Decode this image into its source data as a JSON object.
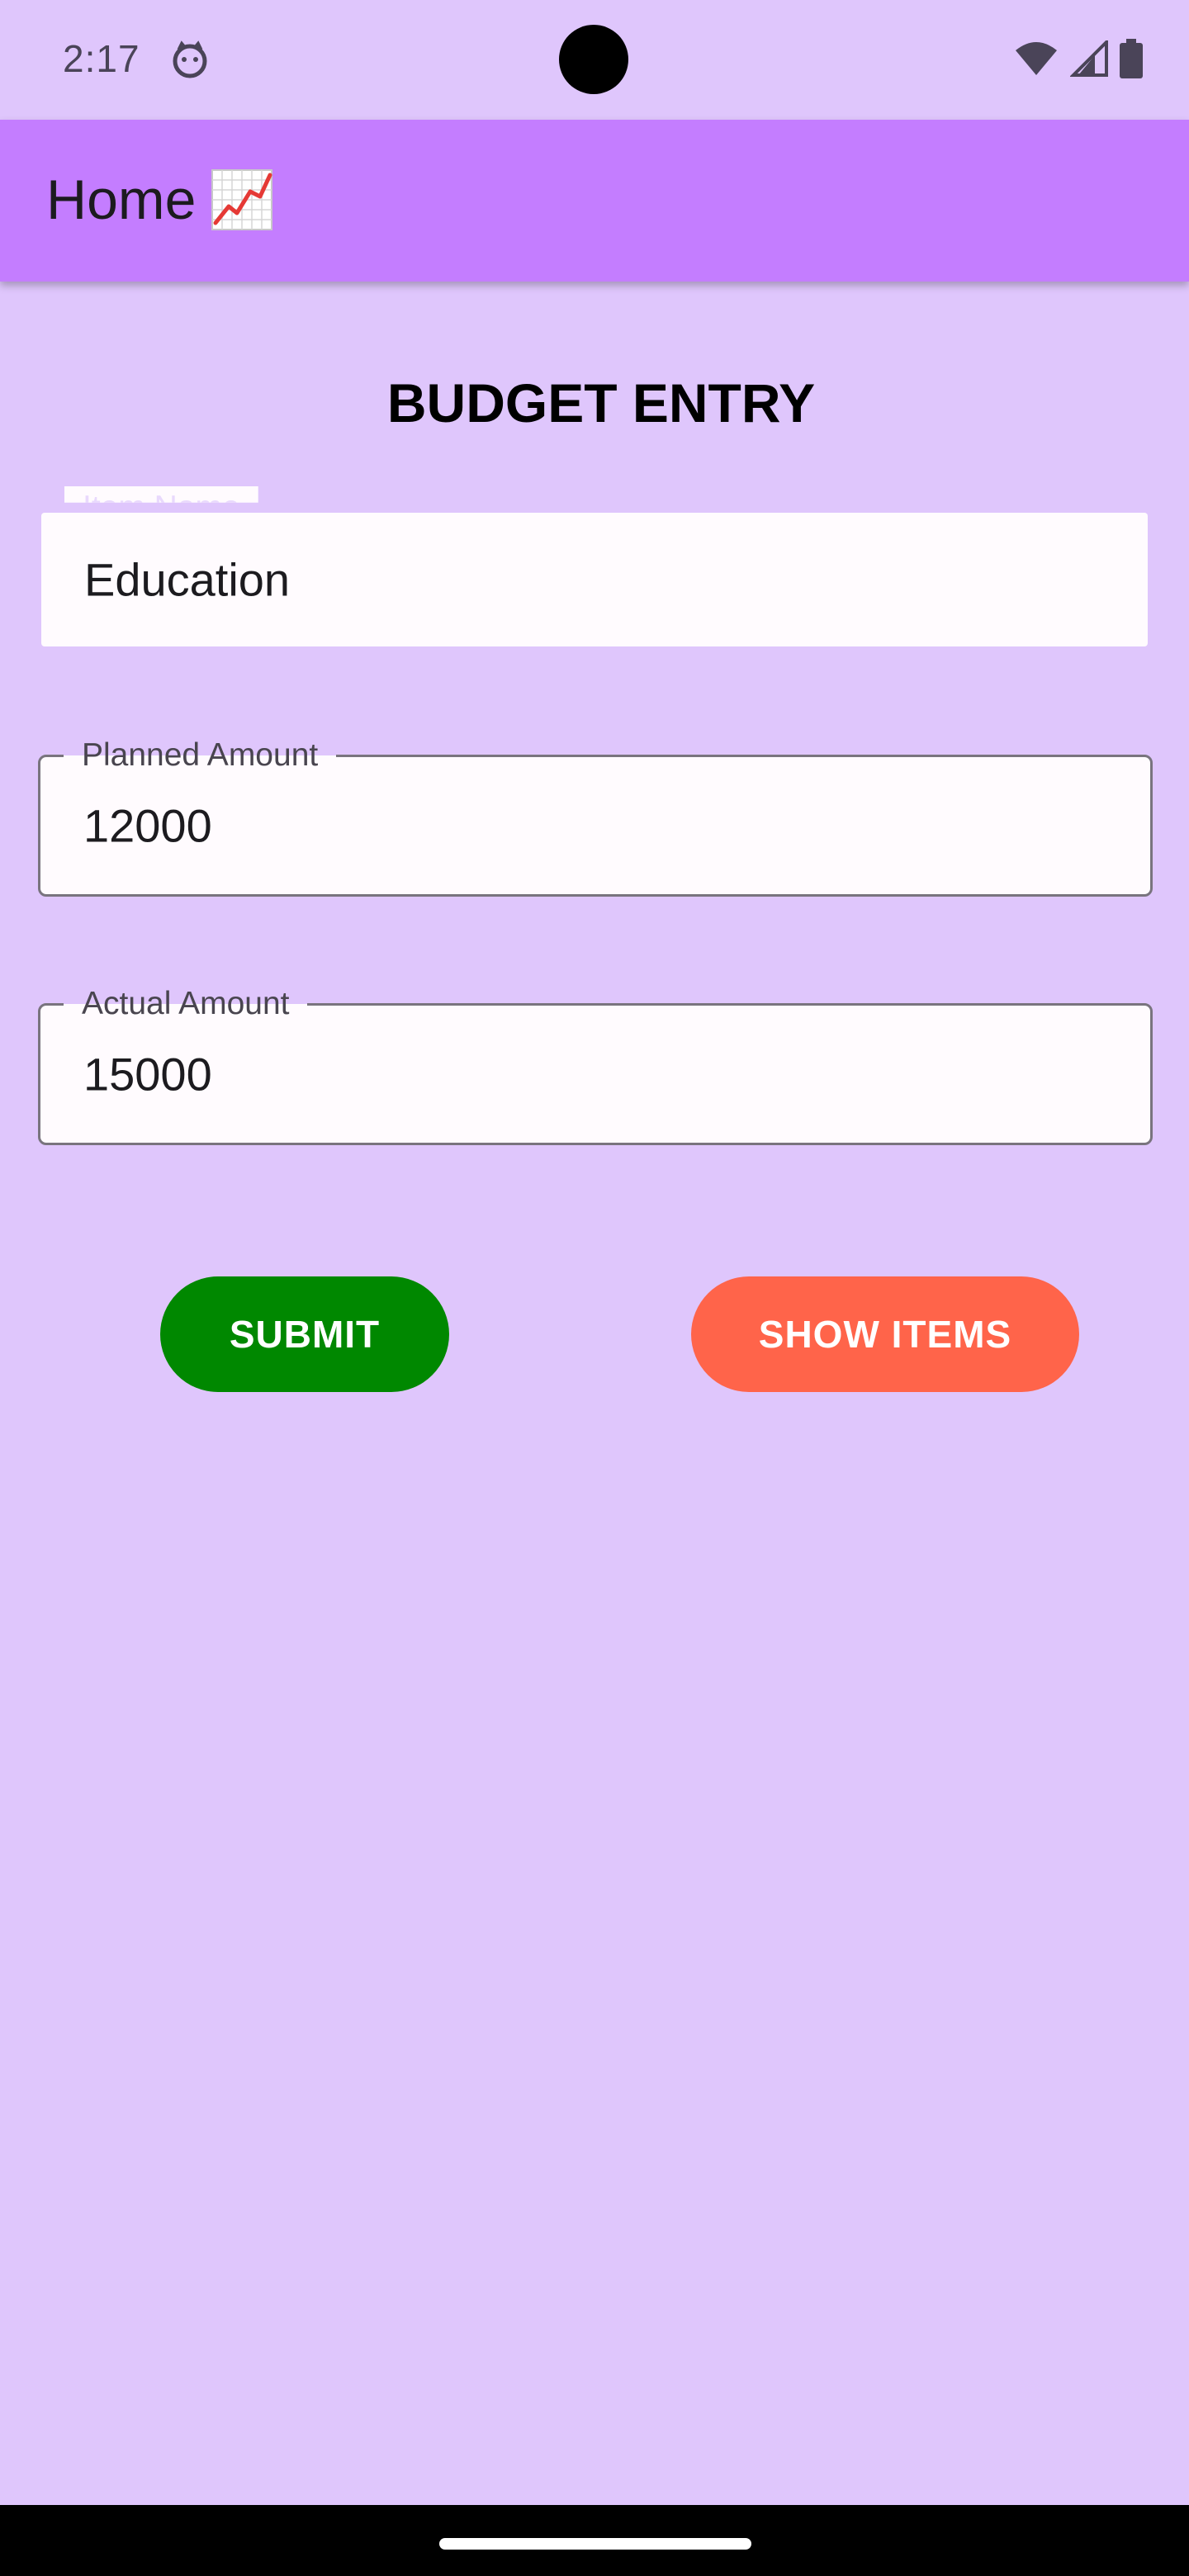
{
  "status_bar": {
    "time": "2:17"
  },
  "app_bar": {
    "title": "Home",
    "title_icon": "chart-increasing-icon"
  },
  "form": {
    "heading": "BUDGET ENTRY",
    "item_name": {
      "label": "Item Name",
      "value": "Education"
    },
    "planned_amount": {
      "label": "Planned Amount",
      "value": "12000"
    },
    "actual_amount": {
      "label": "Actual Amount",
      "value": "15000"
    }
  },
  "buttons": {
    "submit_label": "SUBMIT",
    "show_items_label": "SHOW ITEMS"
  },
  "colors": {
    "background": "#dfc6fc",
    "app_bar": "#c47dff",
    "submit": "#008800",
    "show_items": "#ff644a"
  }
}
